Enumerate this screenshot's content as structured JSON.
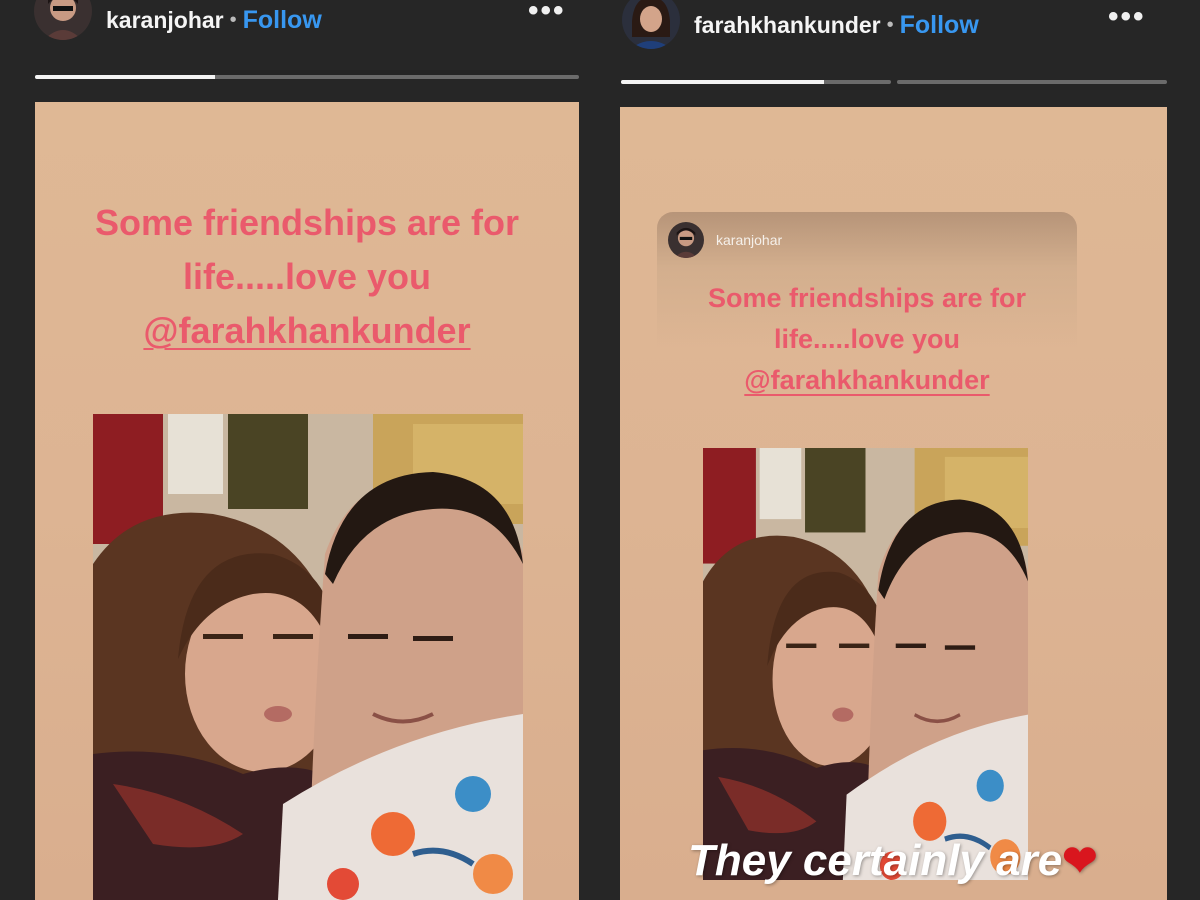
{
  "left_story": {
    "username": "karanjohar",
    "separator": "•",
    "follow_label": "Follow",
    "more_label": "•••",
    "progress": [
      0.33
    ],
    "caption_line1": "Some friendships are for",
    "caption_line2": "life.....love you",
    "caption_mention": "@farahkhankunder",
    "photo_icon": "selfie-photo"
  },
  "right_story": {
    "username": "farahkhankunder",
    "separator": "•",
    "follow_label": "Follow",
    "more_label": "•••",
    "progress": [
      0.75,
      0
    ],
    "repost": {
      "username": "karanjohar",
      "caption_line1": "Some friendships are for",
      "caption_line2": "life.....love you",
      "caption_mention": "@farahkhankunder"
    },
    "overlay_text": "They certainly are",
    "overlay_icon": "heart-icon",
    "photo_icon": "selfie-photo"
  },
  "colors": {
    "background": "#262626",
    "card": "#ddb493",
    "caption": "#ea5a6c",
    "follow": "#3897f0",
    "heart": "#d9161e"
  }
}
